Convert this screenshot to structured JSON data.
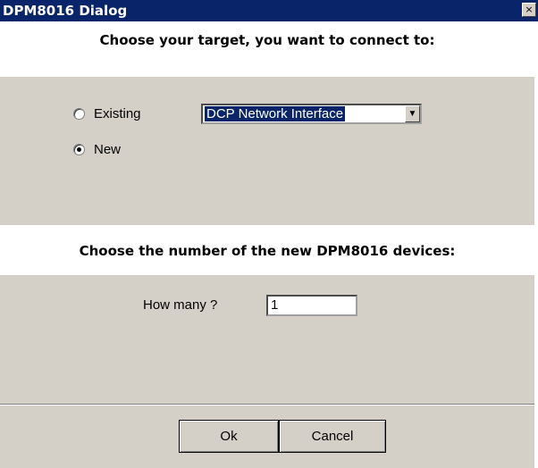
{
  "window": {
    "title": "DPM8016 Dialog",
    "close_glyph": "×"
  },
  "target_section": {
    "heading": "Choose your target, you want to connect to:",
    "options": [
      {
        "label": "Existing",
        "checked": false
      },
      {
        "label": "New",
        "checked": true
      }
    ],
    "combo": {
      "value": "DCP Network Interface",
      "arrow": "▼"
    }
  },
  "count_section": {
    "heading": "Choose the number of the new DPM8016 devices:",
    "how_many_label": "How many ?",
    "how_many_value": "1"
  },
  "buttons": {
    "ok": "Ok",
    "cancel": "Cancel"
  }
}
